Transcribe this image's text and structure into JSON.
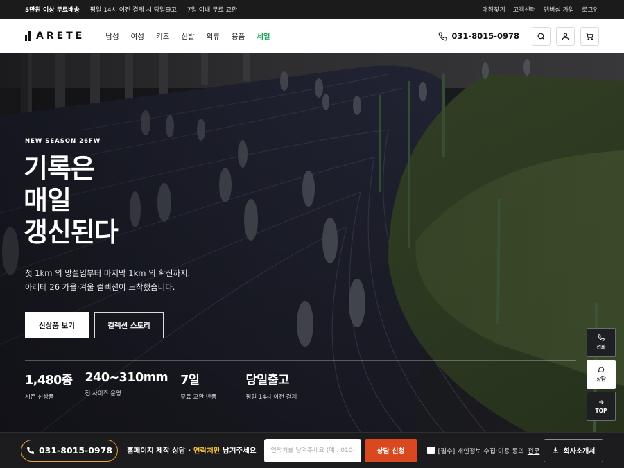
{
  "topbar": {
    "free_shipping": "5만원 이상 무료배송",
    "same_day": "평일 14시 이전 결제 시 당일출고",
    "exchange": "7일 이내 무료 교환",
    "links": [
      "매장찾기",
      "고객센터",
      "멤버십 가입",
      "로그인"
    ]
  },
  "header": {
    "logo_text": "ARETE",
    "nav": [
      "남성",
      "여성",
      "키즈",
      "신발",
      "의류",
      "용품",
      "세일"
    ],
    "phone": "031-8015-0978"
  },
  "hero": {
    "eyebrow": "NEW SEASON 26FW",
    "headline_1": "기록은",
    "headline_2": "매일",
    "headline_3": "갱신된다",
    "sub_1": "첫 1km 의 망설임부터 마지막 1km 의 확신까지.",
    "sub_2": "아레테 26 가을·겨울 컬렉션이 도착했습니다.",
    "btn_primary": "신상품 보기",
    "btn_secondary": "컬렉션 스토리",
    "stats": [
      {
        "value": "1,480종",
        "label": "시즌 신상품"
      },
      {
        "value": "240~310mm",
        "label": "전 사이즈 운영"
      },
      {
        "value": "7일",
        "label": "무료 교환·반품"
      },
      {
        "value": "당일출고",
        "label": "평일 14시 이전 결제"
      }
    ]
  },
  "side": {
    "call": "전화",
    "consult": "상담",
    "top": "TOP"
  },
  "bottom": {
    "phone": "031-8015-0978",
    "text_a": "홈페이지 제작 상담 · ",
    "text_hl": "연락처만",
    "text_b": " 남겨주세요",
    "input_placeholder": "연락처를 남겨주세요 (예 : 010-",
    "apply": "상담 신청",
    "agree_text": "[필수] 개인정보 수집·이용 동의",
    "agree_link": "전문",
    "brochure": "회사소개서"
  },
  "colors": {
    "accent_sale": "#1aa05a",
    "accent_orange": "#d9481f",
    "accent_gold": "#e8a537",
    "highlight_yellow": "#f3c23a"
  }
}
